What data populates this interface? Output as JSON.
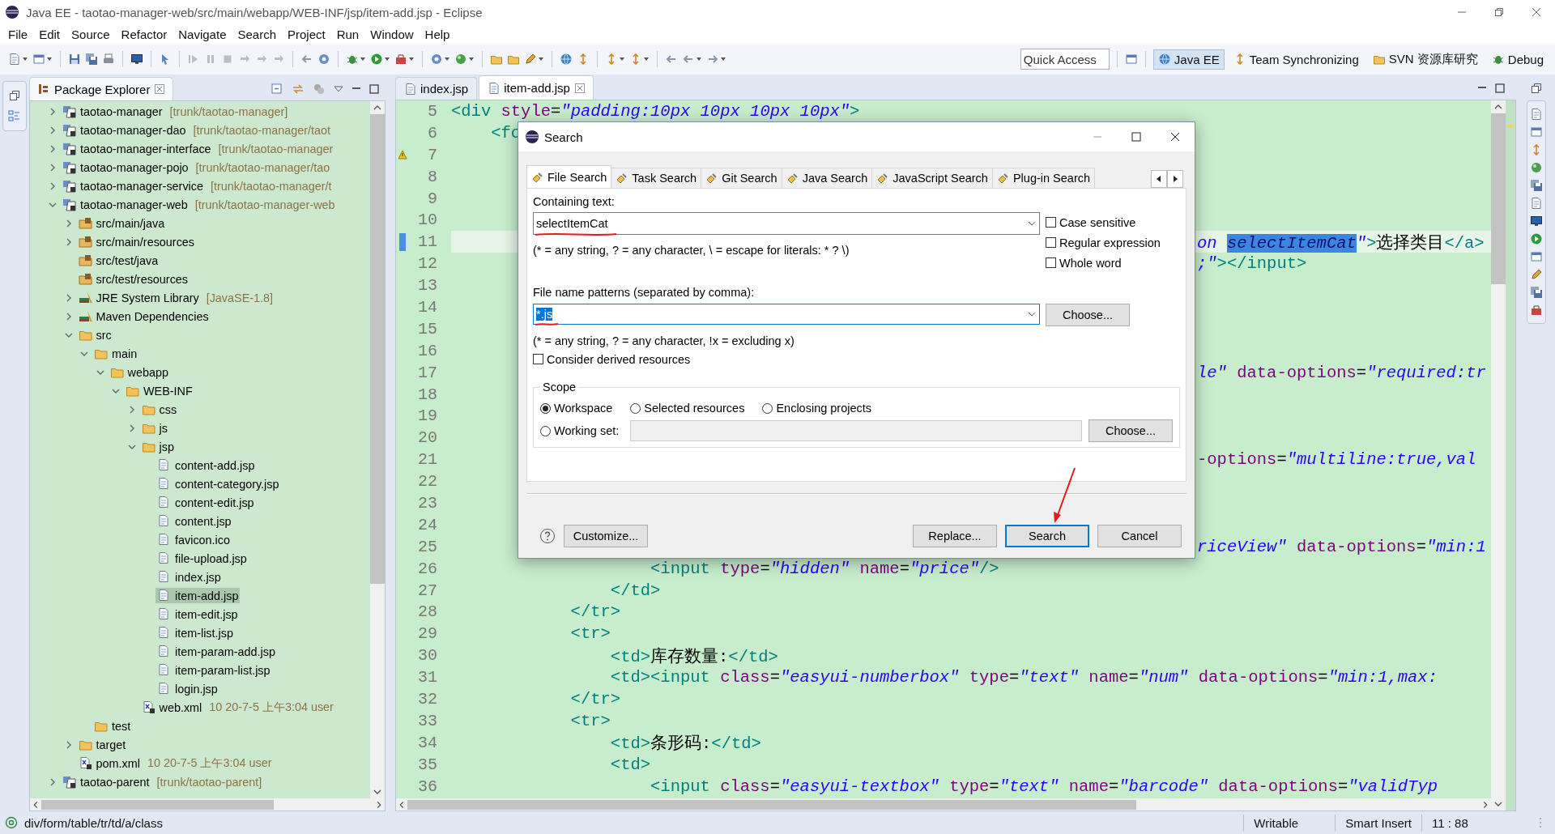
{
  "window": {
    "title": "Java EE - taotao-manager-web/src/main/webapp/WEB-INF/jsp/item-add.jsp - Eclipse"
  },
  "menu": [
    "File",
    "Edit",
    "Source",
    "Refactor",
    "Navigate",
    "Search",
    "Project",
    "Run",
    "Window",
    "Help"
  ],
  "quick_access": {
    "placeholder": "Quick Access"
  },
  "perspectives": [
    {
      "label": "Java EE",
      "selected": true
    },
    {
      "label": "Team Synchronizing",
      "selected": false
    },
    {
      "label": "SVN 资源库研究",
      "selected": false
    },
    {
      "label": "Debug",
      "selected": false
    }
  ],
  "package_explorer": {
    "title": "Package Explorer",
    "tree": [
      {
        "label": "taotao-manager",
        "decoration": "[trunk/taotao-manager]",
        "kind": "project",
        "expanded": false,
        "selected": false
      },
      {
        "label": "taotao-manager-dao",
        "decoration": "[trunk/taotao-manager/taot",
        "kind": "project",
        "expanded": false,
        "selected": false
      },
      {
        "label": "taotao-manager-interface",
        "decoration": "[trunk/taotao-manager",
        "kind": "project",
        "expanded": false,
        "selected": false
      },
      {
        "label": "taotao-manager-pojo",
        "decoration": "[trunk/taotao-manager/tao",
        "kind": "project",
        "expanded": false,
        "selected": false
      },
      {
        "label": "taotao-manager-service",
        "decoration": "[trunk/taotao-manager/t",
        "kind": "project",
        "expanded": false,
        "selected": false
      },
      {
        "label": "taotao-manager-web",
        "decoration": "[trunk/taotao-manager-web",
        "kind": "project",
        "expanded": true,
        "selected": false,
        "children": [
          {
            "label": "src/main/java",
            "kind": "source-folder",
            "expanded": false,
            "selected": false
          },
          {
            "label": "src/main/resources",
            "kind": "source-folder",
            "expanded": false,
            "selected": false
          },
          {
            "label": "src/test/java",
            "kind": "source-folder",
            "selected": false
          },
          {
            "label": "src/test/resources",
            "kind": "source-folder",
            "selected": false
          },
          {
            "label": "JRE System Library",
            "decoration": "[JavaSE-1.8]",
            "kind": "library",
            "expanded": false,
            "selected": false
          },
          {
            "label": "Maven Dependencies",
            "kind": "library",
            "expanded": false,
            "selected": false
          },
          {
            "label": "src",
            "kind": "folder",
            "expanded": true,
            "selected": false,
            "children": [
              {
                "label": "main",
                "kind": "folder",
                "expanded": true,
                "selected": false,
                "children": [
                  {
                    "label": "webapp",
                    "kind": "folder",
                    "expanded": true,
                    "selected": false,
                    "children": [
                      {
                        "label": "WEB-INF",
                        "kind": "folder",
                        "expanded": true,
                        "selected": false,
                        "children": [
                          {
                            "label": "css",
                            "kind": "folder",
                            "expanded": false,
                            "selected": false
                          },
                          {
                            "label": "js",
                            "kind": "folder",
                            "expanded": false,
                            "selected": false
                          },
                          {
                            "label": "jsp",
                            "kind": "folder",
                            "expanded": true,
                            "selected": false,
                            "children": [
                              {
                                "label": "content-add.jsp",
                                "kind": "file",
                                "selected": false
                              },
                              {
                                "label": "content-category.jsp",
                                "kind": "file",
                                "selected": false
                              },
                              {
                                "label": "content-edit.jsp",
                                "kind": "file",
                                "selected": false
                              },
                              {
                                "label": "content.jsp",
                                "kind": "file",
                                "selected": false
                              },
                              {
                                "label": "favicon.ico",
                                "kind": "file",
                                "selected": false
                              },
                              {
                                "label": "file-upload.jsp",
                                "kind": "file",
                                "selected": false
                              },
                              {
                                "label": "index.jsp",
                                "kind": "file",
                                "selected": false
                              },
                              {
                                "label": "item-add.jsp",
                                "kind": "file",
                                "selected": true
                              },
                              {
                                "label": "item-edit.jsp",
                                "kind": "file",
                                "selected": false
                              },
                              {
                                "label": "item-list.jsp",
                                "kind": "file",
                                "selected": false
                              },
                              {
                                "label": "item-param-add.jsp",
                                "kind": "file",
                                "selected": false
                              },
                              {
                                "label": "item-param-list.jsp",
                                "kind": "file",
                                "selected": false
                              },
                              {
                                "label": "login.jsp",
                                "kind": "file",
                                "selected": false
                              }
                            ]
                          },
                          {
                            "label": "web.xml",
                            "decoration": "10  20-7-5 上午3:04  user",
                            "kind": "xml",
                            "selected": false
                          }
                        ]
                      }
                    ]
                  }
                ]
              },
              {
                "label": "test",
                "kind": "folder",
                "selected": false
              }
            ]
          },
          {
            "label": "target",
            "kind": "folder",
            "expanded": false,
            "selected": false
          },
          {
            "label": "pom.xml",
            "decoration": "10  20-7-5 上午3:04  user",
            "kind": "xml",
            "selected": false
          }
        ]
      },
      {
        "label": "taotao-parent",
        "decoration": "[trunk/taotao-parent]",
        "kind": "project",
        "expanded": false,
        "selected": false
      }
    ]
  },
  "editor": {
    "tabs": [
      {
        "label": "index.jsp",
        "selected": false
      },
      {
        "label": "item-add.jsp",
        "selected": true
      }
    ],
    "lines": [
      {
        "number": "5",
        "current": false,
        "warning": false,
        "tokens": [
          {
            "kind": "tag",
            "text": "<div"
          },
          {
            "kind": "attr",
            "text": " style"
          },
          {
            "kind": "plain",
            "text": "="
          },
          {
            "kind": "value",
            "text": "\"padding:10px 10px 10px 10px\""
          },
          {
            "kind": "tag",
            "text": ">"
          }
        ]
      },
      {
        "number": "6",
        "current": false,
        "warning": false,
        "tokens": [
          {
            "kind": "tag",
            "text": "    <fo"
          }
        ]
      },
      {
        "number": "7",
        "current": false,
        "warning": true
      },
      {
        "number": "8",
        "current": false,
        "warning": false
      },
      {
        "number": "9",
        "current": false,
        "warning": false
      },
      {
        "number": "10",
        "current": false,
        "warning": false
      },
      {
        "number": "11",
        "current": true,
        "warning": false,
        "occluded": true,
        "tokens": [
          {
            "kind": "value",
            "text": "on "
          },
          {
            "kind": "match",
            "text": "selectItemCat"
          },
          {
            "kind": "value",
            "text": "\""
          },
          {
            "kind": "tag",
            "text": ">"
          },
          {
            "kind": "text",
            "text": "选择类目"
          },
          {
            "kind": "tag",
            "text": "</a>"
          }
        ]
      },
      {
        "number": "12",
        "current": false,
        "warning": false,
        "occluded": true,
        "tokens": [
          {
            "kind": "value",
            "text": ";\""
          },
          {
            "kind": "tag",
            "text": "></input>"
          }
        ]
      },
      {
        "number": "13",
        "current": false,
        "warning": false
      },
      {
        "number": "14",
        "current": false,
        "warning": false
      },
      {
        "number": "15",
        "current": false,
        "warning": false
      },
      {
        "number": "16",
        "current": false,
        "warning": false
      },
      {
        "number": "17",
        "current": false,
        "warning": false,
        "occluded": true,
        "tokens": [
          {
            "kind": "value",
            "text": "le\""
          },
          {
            "kind": "attr",
            "text": " data-options"
          },
          {
            "kind": "plain",
            "text": "="
          },
          {
            "kind": "value",
            "text": "\"required:tr"
          }
        ]
      },
      {
        "number": "18",
        "current": false,
        "warning": false
      },
      {
        "number": "19",
        "current": false,
        "warning": false
      },
      {
        "number": "20",
        "current": false,
        "warning": false
      },
      {
        "number": "21",
        "current": false,
        "warning": false,
        "occluded": true,
        "tokens": [
          {
            "kind": "attr",
            "text": "-options"
          },
          {
            "kind": "plain",
            "text": "="
          },
          {
            "kind": "value",
            "text": "\"multiline:true,val"
          }
        ]
      },
      {
        "number": "22",
        "current": false,
        "warning": false
      },
      {
        "number": "23",
        "current": false,
        "warning": false
      },
      {
        "number": "24",
        "current": false,
        "warning": false
      },
      {
        "number": "25",
        "current": false,
        "warning": false,
        "occluded": true,
        "tokens": [
          {
            "kind": "value",
            "text": "riceView\""
          },
          {
            "kind": "attr",
            "text": " data-options"
          },
          {
            "kind": "plain",
            "text": "="
          },
          {
            "kind": "value",
            "text": "\"min:1"
          }
        ]
      },
      {
        "number": "26",
        "current": false,
        "warning": false,
        "tokens": [
          {
            "kind": "tag",
            "text": "                    <input"
          },
          {
            "kind": "attr",
            "text": " type"
          },
          {
            "kind": "plain",
            "text": "="
          },
          {
            "kind": "value",
            "text": "\"hidden\""
          },
          {
            "kind": "attr",
            "text": " name"
          },
          {
            "kind": "plain",
            "text": "="
          },
          {
            "kind": "value",
            "text": "\"price\""
          },
          {
            "kind": "tag",
            "text": "/>"
          }
        ]
      },
      {
        "number": "27",
        "current": false,
        "warning": false,
        "tokens": [
          {
            "kind": "tag",
            "text": "                </td>"
          }
        ]
      },
      {
        "number": "28",
        "current": false,
        "warning": false,
        "tokens": [
          {
            "kind": "tag",
            "text": "            </tr>"
          }
        ]
      },
      {
        "number": "29",
        "current": false,
        "warning": false,
        "tokens": [
          {
            "kind": "tag",
            "text": "            <tr>"
          }
        ]
      },
      {
        "number": "30",
        "current": false,
        "warning": false,
        "tokens": [
          {
            "kind": "tag",
            "text": "                <td>"
          },
          {
            "kind": "text",
            "text": "库存数量:"
          },
          {
            "kind": "tag",
            "text": "</td>"
          }
        ]
      },
      {
        "number": "31",
        "current": false,
        "warning": false,
        "tokens": [
          {
            "kind": "tag",
            "text": "                <td><input"
          },
          {
            "kind": "attr",
            "text": " class"
          },
          {
            "kind": "plain",
            "text": "="
          },
          {
            "kind": "value",
            "text": "\"easyui-numberbox\""
          },
          {
            "kind": "attr",
            "text": " type"
          },
          {
            "kind": "plain",
            "text": "="
          },
          {
            "kind": "value",
            "text": "\"text\""
          },
          {
            "kind": "attr",
            "text": " name"
          },
          {
            "kind": "plain",
            "text": "="
          },
          {
            "kind": "value",
            "text": "\"num\""
          },
          {
            "kind": "attr",
            "text": " data-options"
          },
          {
            "kind": "plain",
            "text": "="
          },
          {
            "kind": "value",
            "text": "\"min:1,max:"
          }
        ]
      },
      {
        "number": "32",
        "current": false,
        "warning": false,
        "tokens": [
          {
            "kind": "tag",
            "text": "            </tr>"
          }
        ]
      },
      {
        "number": "33",
        "current": false,
        "warning": false,
        "tokens": [
          {
            "kind": "tag",
            "text": "            <tr>"
          }
        ]
      },
      {
        "number": "34",
        "current": false,
        "warning": false,
        "tokens": [
          {
            "kind": "tag",
            "text": "                <td>"
          },
          {
            "kind": "text",
            "text": "条形码:"
          },
          {
            "kind": "tag",
            "text": "</td>"
          }
        ]
      },
      {
        "number": "35",
        "current": false,
        "warning": false,
        "tokens": [
          {
            "kind": "tag",
            "text": "                <td>"
          }
        ]
      },
      {
        "number": "36",
        "current": false,
        "warning": false,
        "tokens": [
          {
            "kind": "tag",
            "text": "                    <input"
          },
          {
            "kind": "attr",
            "text": " class"
          },
          {
            "kind": "plain",
            "text": "="
          },
          {
            "kind": "value",
            "text": "\"easyui-textbox\""
          },
          {
            "kind": "attr",
            "text": " type"
          },
          {
            "kind": "plain",
            "text": "="
          },
          {
            "kind": "value",
            "text": "\"text\""
          },
          {
            "kind": "attr",
            "text": " name"
          },
          {
            "kind": "plain",
            "text": "="
          },
          {
            "kind": "value",
            "text": "\"barcode\""
          },
          {
            "kind": "attr",
            "text": " data-options"
          },
          {
            "kind": "plain",
            "text": "="
          },
          {
            "kind": "value",
            "text": "\"validTyp"
          }
        ]
      }
    ]
  },
  "search_dialog": {
    "title": "Search",
    "tabs": [
      {
        "label": "File Search",
        "selected": true
      },
      {
        "label": "Task Search",
        "selected": false
      },
      {
        "label": "Git Search",
        "selected": false
      },
      {
        "label": "Java Search",
        "selected": false
      },
      {
        "label": "JavaScript Search",
        "selected": false
      },
      {
        "label": "Plug-in Search",
        "selected": false
      }
    ],
    "containing_label": "Containing text:",
    "containing_value": "selectItemCat",
    "options": [
      {
        "label": "Case sensitive",
        "checked": false
      },
      {
        "label": "Regular expression",
        "checked": false
      },
      {
        "label": "Whole word",
        "checked": false
      }
    ],
    "containing_hint": "(* = any string, ? = any character, \\ = escape for literals: * ? \\)",
    "patterns_label": "File name patterns (separated by comma):",
    "patterns_value": "*.js",
    "patterns_selected": true,
    "choose_button": "Choose...",
    "patterns_hint": "(* = any string, ? = any character, !x = excluding x)",
    "derived": {
      "label": "Consider derived resources",
      "checked": false
    },
    "scope": {
      "title": "Scope",
      "options": [
        {
          "label": "Workspace",
          "selected": true
        },
        {
          "label": "Selected resources",
          "selected": false
        },
        {
          "label": "Enclosing projects",
          "selected": false
        },
        {
          "label": "Working set:",
          "selected": false
        }
      ],
      "choose_button": "Choose..."
    },
    "buttons": [
      {
        "label": "Customize...",
        "default": false
      },
      {
        "label": "Replace...",
        "default": false
      },
      {
        "label": "Search",
        "default": true
      },
      {
        "label": "Cancel",
        "default": false
      }
    ]
  },
  "status_bar": {
    "path": "div/form/table/tr/td/a/class",
    "mode": "Writable",
    "insert_mode": "Smart Insert",
    "position": "11 : 88"
  }
}
